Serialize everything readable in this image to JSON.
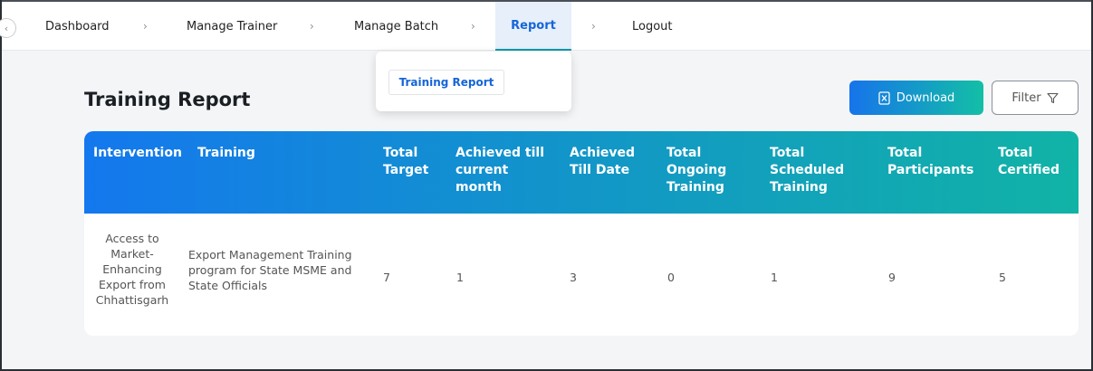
{
  "nav": {
    "items": [
      {
        "label": "Dashboard"
      },
      {
        "label": "Manage Trainer"
      },
      {
        "label": "Manage Batch"
      },
      {
        "label": "Report"
      },
      {
        "label": "Logout"
      }
    ],
    "separator": "›",
    "back_icon": "chevron-left-icon"
  },
  "dropdown": {
    "items": [
      {
        "label": "Training Report"
      }
    ]
  },
  "page": {
    "title": "Training Report"
  },
  "actions": {
    "download_label": "Download",
    "download_icon": "excel-file-icon",
    "filter_label": "Filter",
    "filter_icon": "filter-funnel-icon"
  },
  "table": {
    "columns": [
      {
        "label": "Intervention"
      },
      {
        "label": "Training"
      },
      {
        "label": "Total Target"
      },
      {
        "label": "Achieved till current month"
      },
      {
        "label": "Achieved Till Date"
      },
      {
        "label": "Total Ongoing Training"
      },
      {
        "label": "Total Scheduled Training"
      },
      {
        "label": "Total Participants"
      },
      {
        "label": "Total Certified"
      }
    ],
    "rows": [
      {
        "intervention": "Access to Market- Enhancing Export from Chhattisgarh",
        "training": "Export Management Training program for State MSME and State Officials",
        "total_target": "7",
        "achieved_current_month": "1",
        "achieved_till_date": "3",
        "total_ongoing": "0",
        "total_scheduled": "1",
        "total_participants": "9",
        "total_certified": "5"
      }
    ]
  },
  "colors": {
    "accent_blue": "#1565d8",
    "header_gradient_start": "#1478ee",
    "header_gradient_end": "#11b3a6"
  }
}
